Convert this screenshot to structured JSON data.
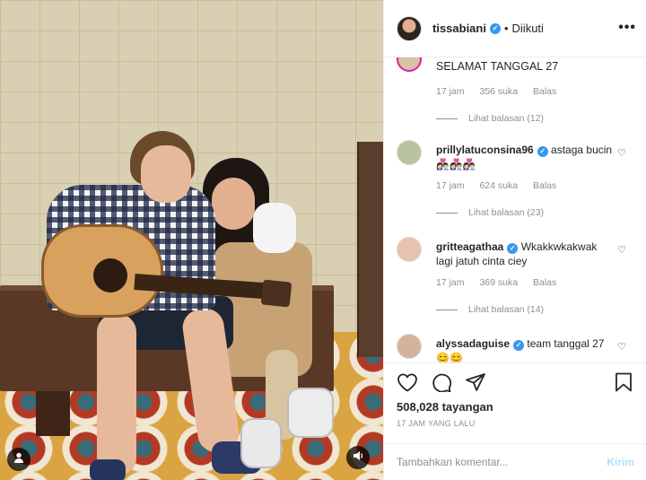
{
  "post": {
    "username": "tissabiani",
    "follow_status": "Diikuti",
    "views": "508,028 tayangan",
    "time_ago": "17 JAM YANG LALU"
  },
  "comments": [
    {
      "username": "",
      "text": "SELAMAT TANGGAL 27",
      "time": "17 jam",
      "likes": "356 suka",
      "reply": "Balas",
      "view_replies": "Lihat balasan (12)"
    },
    {
      "username": "prillylatuconsina96",
      "text": "astaga bucin 👩🏻‍❤️‍👨🏻👩🏻‍❤️‍👨🏻👩🏻‍❤️‍👨🏻",
      "time": "17 jam",
      "likes": "624 suka",
      "reply": "Balas",
      "view_replies": "Lihat balasan (23)"
    },
    {
      "username": "gritteagathaa",
      "text": "Wkakkwkakwak lagi jatuh cinta ciey",
      "time": "17 jam",
      "likes": "369 suka",
      "reply": "Balas",
      "view_replies": "Lihat balasan (14)"
    },
    {
      "username": "alyssadaguise",
      "text": "team tanggal 27 😊😊"
    }
  ],
  "comment_input": {
    "placeholder": "Tambahkan komentar...",
    "post_label": "Kirim"
  },
  "icons": {
    "like": "heart-icon",
    "comment": "comment-icon",
    "share": "share-icon",
    "save": "bookmark-icon",
    "more": "more-options-icon",
    "tags": "user-tag-icon",
    "audio": "audio-icon"
  },
  "colors": {
    "verified": "#3897f0",
    "muted_text": "#8e8e8e",
    "post_button": "#b2dffc"
  }
}
